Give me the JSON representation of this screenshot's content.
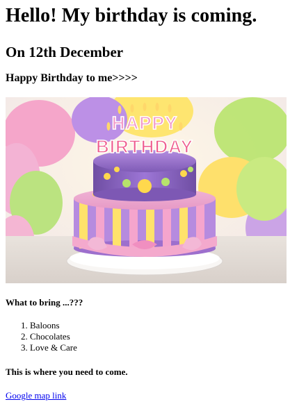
{
  "header": {
    "title": "Hello! My birthday is coming.",
    "date": "On 12th December",
    "greeting": "Happy Birthday to me>>>>"
  },
  "image": {
    "subject": "birthday-cake-image",
    "topper_top": "HAPPY",
    "topper_bottom": "BIRTHDAY"
  },
  "bring": {
    "heading": "What to bring ...???",
    "items": [
      "Baloons",
      "Chocolates",
      "Love & Care"
    ]
  },
  "location": {
    "heading": "This is where you need to come.",
    "link_text": "Google map link"
  }
}
